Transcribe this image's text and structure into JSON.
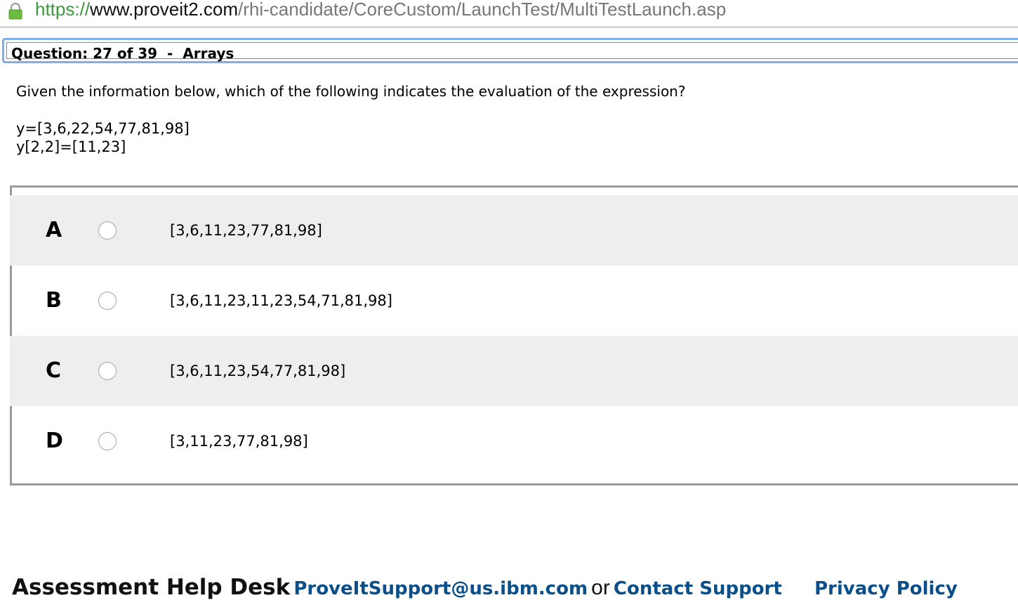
{
  "browser": {
    "url_scheme": "https://",
    "url_host": "www.proveit2.com",
    "url_path": "/rhi-candidate/CoreCustom/LaunchTest/MultiTestLaunch.asp",
    "lock_icon": "lock-icon",
    "lock_color": "#6dbb3f"
  },
  "question": {
    "title": "Question: 27 of 39  -  Arrays",
    "prompt": "Given the information below, which of the following indicates the evaluation of the expression?",
    "code_lines": [
      "y=[3,6,22,54,77,81,98]",
      "y[2,2]=[11,23]"
    ]
  },
  "answers": [
    {
      "letter": "A",
      "text": "[3,6,11,23,77,81,98]"
    },
    {
      "letter": "B",
      "text": "[3,6,11,23,11,23,54,71,81,98]"
    },
    {
      "letter": "C",
      "text": "[3,6,11,23,54,77,81,98]"
    },
    {
      "letter": "D",
      "text": "[3,11,23,77,81,98]"
    }
  ],
  "footer": {
    "help_desk": "Assessment Help Desk",
    "support_email": "ProveItSupport@us.ibm.com",
    "or": "or",
    "contact_support": "Contact Support",
    "privacy_policy": "Privacy Policy"
  },
  "colors": {
    "header_border": "#7fb0ea",
    "row_shade": "#eeeeee",
    "link": "#0b4f8a"
  }
}
